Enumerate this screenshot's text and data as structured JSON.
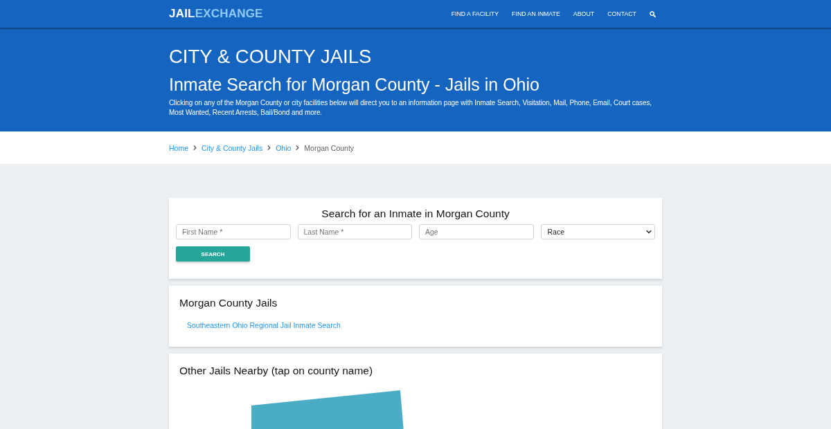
{
  "header": {
    "logo": {
      "text_1": "JAIL",
      "text_2": "EXCHANGE"
    },
    "nav_links": [
      "FIND A FACILITY",
      "FIND AN INMATE",
      "ABOUT",
      "CONTACT"
    ]
  },
  "hero": {
    "eyebrow": "CITY & COUNTY JAILS",
    "title": "Inmate Search for Morgan County - Jails in Ohio",
    "description": "Clicking on any of the Morgan County or city facilities below will direct you to an information page with Inmate Search, Visitation, Mail, Phone, Email, Court cases, Most Wanted, Recent Arrests, Bail/Bond and more."
  },
  "breadcrumb": [
    {
      "label": "Home",
      "kind": "link"
    },
    {
      "label": "City & County Jails",
      "kind": "link"
    },
    {
      "label": "Ohio",
      "kind": "link"
    },
    {
      "label": "Morgan County",
      "kind": "current"
    }
  ],
  "search_card": {
    "title": "Search for an Inmate in Morgan County",
    "fields": [
      {
        "kind": "text",
        "placeholder": "First Name *"
      },
      {
        "kind": "text",
        "placeholder": "Last Name *"
      },
      {
        "kind": "text",
        "placeholder": "Age"
      },
      {
        "kind": "select",
        "value": "Race"
      }
    ],
    "button": "SEARCH"
  },
  "jails_card": {
    "title": "Morgan County Jails",
    "links": [
      "Southeastern Ohio Regional Jail Inmate Search"
    ]
  },
  "nearby_card": {
    "title": "Other Jails Nearby (tap on county name)"
  }
}
